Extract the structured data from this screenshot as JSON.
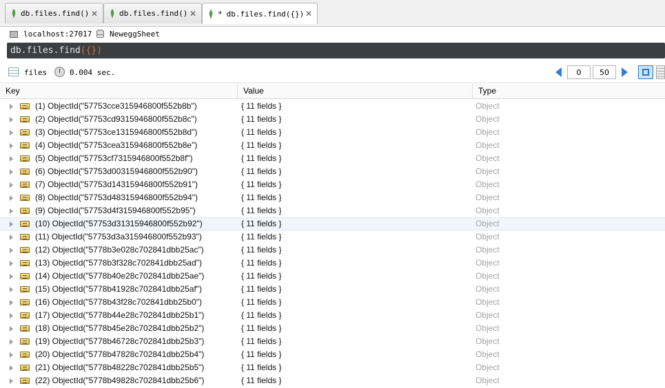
{
  "tabs": [
    {
      "label": "db.files.find()",
      "modified": false,
      "active": false
    },
    {
      "label": "db.files.find()",
      "modified": false,
      "active": false
    },
    {
      "label": "db.files.find({})",
      "modified": true,
      "active": true
    }
  ],
  "tab_modified_marker": "*",
  "tab_close_glyph": "✕",
  "connection": {
    "host": "localhost:27017",
    "database": "NeweggSheet"
  },
  "query": {
    "command": "db.files.find",
    "args": "({})"
  },
  "toolbar": {
    "collection": "files",
    "elapsed": "0.004 sec.",
    "skip": "0",
    "limit": "50"
  },
  "columns": {
    "key": "Key",
    "value": "Value",
    "type": "Type"
  },
  "rows": [
    {
      "key": "(1) ObjectId(\"57753cce315946800f552b8b\")",
      "value": "{ 11 fields }",
      "type": "Object"
    },
    {
      "key": "(2) ObjectId(\"57753cd9315946800f552b8c\")",
      "value": "{ 11 fields }",
      "type": "Object"
    },
    {
      "key": "(3) ObjectId(\"57753ce1315946800f552b8d\")",
      "value": "{ 11 fields }",
      "type": "Object"
    },
    {
      "key": "(4) ObjectId(\"57753cea315946800f552b8e\")",
      "value": "{ 11 fields }",
      "type": "Object"
    },
    {
      "key": "(5) ObjectId(\"57753cf7315946800f552b8f\")",
      "value": "{ 11 fields }",
      "type": "Object"
    },
    {
      "key": "(6) ObjectId(\"57753d00315946800f552b90\")",
      "value": "{ 11 fields }",
      "type": "Object"
    },
    {
      "key": "(7) ObjectId(\"57753d14315946800f552b91\")",
      "value": "{ 11 fields }",
      "type": "Object"
    },
    {
      "key": "(8) ObjectId(\"57753d48315946800f552b94\")",
      "value": "{ 11 fields }",
      "type": "Object"
    },
    {
      "key": "(9) ObjectId(\"57753d4f315946800f552b95\")",
      "value": "{ 11 fields }",
      "type": "Object"
    },
    {
      "key": "(10) ObjectId(\"57753d31315946800f552b92\")",
      "value": "{ 11 fields }",
      "type": "Object",
      "selected": true
    },
    {
      "key": "(11) ObjectId(\"57753d3a315946800f552b93\")",
      "value": "{ 11 fields }",
      "type": "Object"
    },
    {
      "key": "(12) ObjectId(\"5778b3e028c702841dbb25ac\")",
      "value": "{ 11 fields }",
      "type": "Object"
    },
    {
      "key": "(13) ObjectId(\"5778b3f328c702841dbb25ad\")",
      "value": "{ 11 fields }",
      "type": "Object"
    },
    {
      "key": "(14) ObjectId(\"5778b40e28c702841dbb25ae\")",
      "value": "{ 11 fields }",
      "type": "Object"
    },
    {
      "key": "(15) ObjectId(\"5778b41928c702841dbb25af\")",
      "value": "{ 11 fields }",
      "type": "Object"
    },
    {
      "key": "(16) ObjectId(\"5778b43f28c702841dbb25b0\")",
      "value": "{ 11 fields }",
      "type": "Object"
    },
    {
      "key": "(17) ObjectId(\"5778b44e28c702841dbb25b1\")",
      "value": "{ 11 fields }",
      "type": "Object"
    },
    {
      "key": "(18) ObjectId(\"5778b45e28c702841dbb25b2\")",
      "value": "{ 11 fields }",
      "type": "Object"
    },
    {
      "key": "(19) ObjectId(\"5778b46728c702841dbb25b3\")",
      "value": "{ 11 fields }",
      "type": "Object"
    },
    {
      "key": "(20) ObjectId(\"5778b47828c702841dbb25b4\")",
      "value": "{ 11 fields }",
      "type": "Object"
    },
    {
      "key": "(21) ObjectId(\"5778b48228c702841dbb25b5\")",
      "value": "{ 11 fields }",
      "type": "Object"
    },
    {
      "key": "(22) ObjectId(\"5778b49828c702841dbb25b6\")",
      "value": "{ 11 fields }",
      "type": "Object"
    }
  ],
  "colors": {
    "query_bg": "#3c3f41",
    "query_args": "#cc7832",
    "leaf_green": "#4fa046",
    "pager_arrow": "#2f7fd8",
    "type_text": "#a3a3a3"
  },
  "icons": {
    "tab": "mongodb-leaf-icon",
    "host": "monitor-icon",
    "database": "database-icon",
    "collection": "grid-icon",
    "time": "clock-icon",
    "row": "object-icon"
  }
}
